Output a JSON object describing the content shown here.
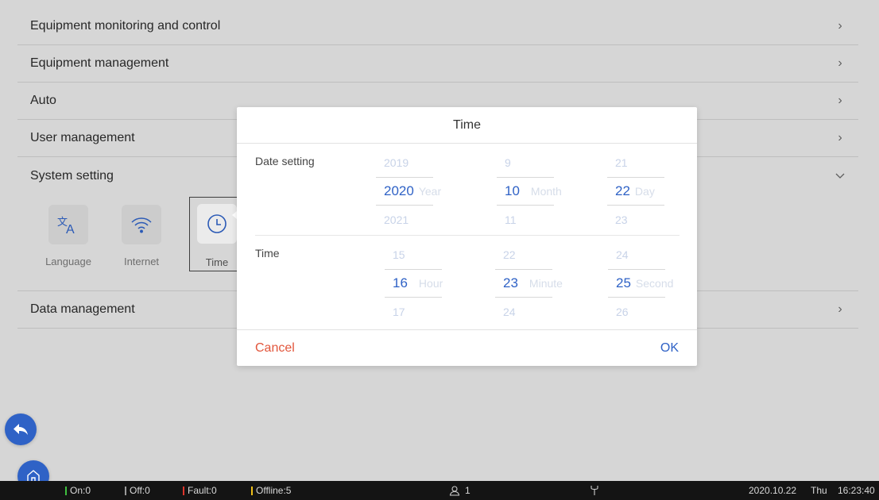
{
  "menu": {
    "items": [
      {
        "label": "Equipment monitoring and control"
      },
      {
        "label": "Equipment management"
      },
      {
        "label": "Auto"
      },
      {
        "label": "User management"
      }
    ],
    "system_setting": {
      "label": "System setting",
      "sub_items": [
        {
          "label": "Language",
          "icon": "language-icon"
        },
        {
          "label": "Internet",
          "icon": "wifi-icon"
        },
        {
          "label": "Time",
          "icon": "clock-icon",
          "selected": true
        }
      ]
    },
    "data_management": {
      "label": "Data management"
    }
  },
  "dialog": {
    "title": "Time",
    "date_section": {
      "label": "Date setting",
      "year": {
        "prev": "2019",
        "value": "2020",
        "unit": "Year",
        "next": "2021"
      },
      "month": {
        "prev": "9",
        "value": "10",
        "unit": "Month",
        "next": "11"
      },
      "day": {
        "prev": "21",
        "value": "22",
        "unit": "Day",
        "next": "23"
      }
    },
    "time_section": {
      "label": "Time",
      "hour": {
        "prev": "15",
        "value": "16",
        "unit": "Hour",
        "next": "17"
      },
      "minute": {
        "prev": "22",
        "value": "23",
        "unit": "Minute",
        "next": "24"
      },
      "second": {
        "prev": "24",
        "value": "25",
        "unit": "Second",
        "next": "26"
      }
    },
    "cancel_label": "Cancel",
    "ok_label": "OK"
  },
  "statusbar": {
    "on": "On:0",
    "off": "Off:0",
    "fault": "Fault:0",
    "offline": "Offline:5",
    "users": "1",
    "date": "2020.10.22",
    "weekday": "Thu",
    "time": "16:23:40"
  },
  "colors": {
    "accent": "#2f62c6",
    "cancel": "#e2563c",
    "on_tick": "#3fbf3f",
    "off_tick": "#9a9a9a",
    "fault_tick": "#e0362c",
    "offline_tick": "#f0c018"
  }
}
